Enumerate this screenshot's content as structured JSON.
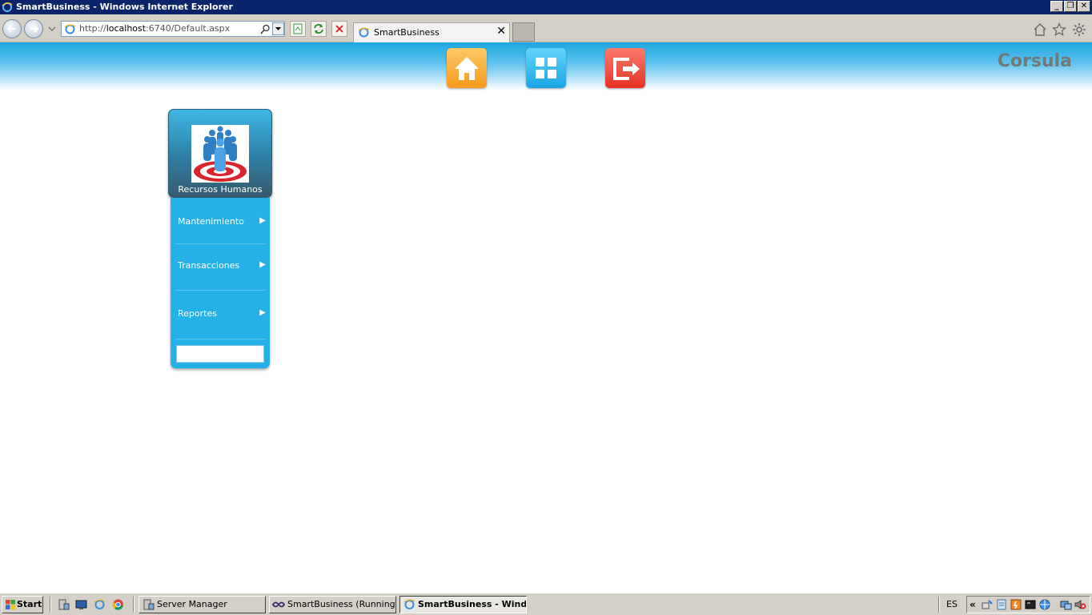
{
  "window": {
    "title": "SmartBusiness - Windows Internet Explorer",
    "controls": {
      "minimize": "_",
      "restore": "❐",
      "close": "✕"
    }
  },
  "browser": {
    "address_prefix": "http://",
    "address_host": "localhost",
    "address_rest": ":6740/Default.aspx",
    "tab_title": "SmartBusiness",
    "tab_close": "✕"
  },
  "app": {
    "brand": "Corsula",
    "tiles": [
      {
        "name": "home",
        "color": "#f7a531"
      },
      {
        "name": "apps",
        "color": "#25b9ef"
      },
      {
        "name": "logout",
        "color": "#f0473a"
      }
    ]
  },
  "menu": {
    "module_title": "Recursos Humanos",
    "items": [
      {
        "label": "Mantenimiento",
        "arrow": "▶"
      },
      {
        "label": "Transacciones",
        "arrow": "▶"
      },
      {
        "label": "Reportes",
        "arrow": "▶"
      }
    ],
    "search_value": ""
  },
  "taskbar": {
    "start": "Start",
    "tasks": [
      {
        "label": "Server Manager"
      },
      {
        "label": "SmartBusiness (Running)..."
      },
      {
        "label": "SmartBusiness - Wind..."
      }
    ],
    "language": "ES",
    "chevron": "«"
  }
}
